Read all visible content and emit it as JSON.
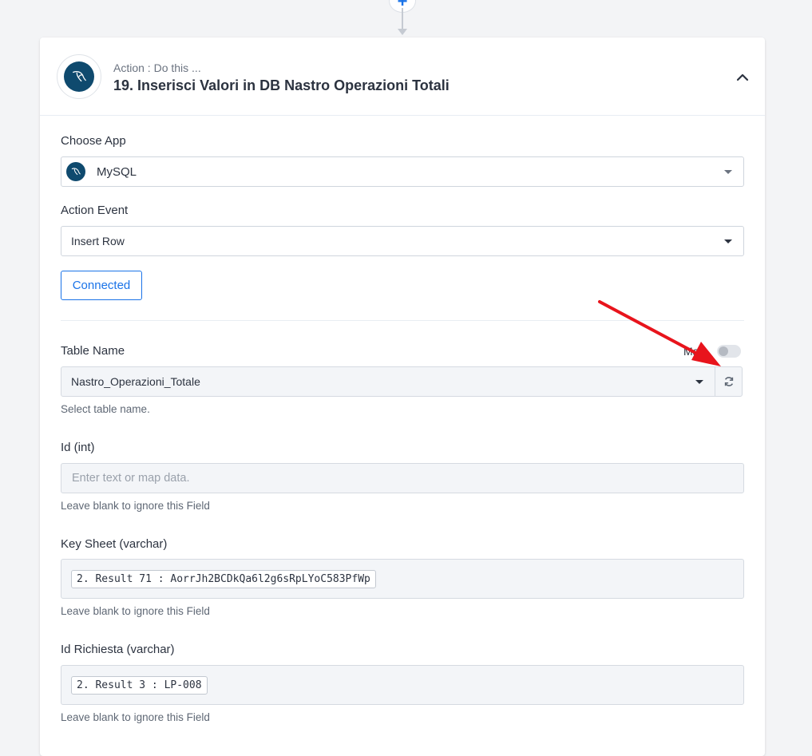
{
  "step": {
    "subtitle": "Action : Do this ...",
    "title": "19. Inserisci Valori in DB Nastro Operazioni Totali"
  },
  "choose_app": {
    "label": "Choose App",
    "value": "MySQL"
  },
  "action_event": {
    "label": "Action Event",
    "value": "Insert Row"
  },
  "connection": {
    "label": "Connected"
  },
  "table_name": {
    "label": "Table Name",
    "toggle_label": "Map",
    "value": "Nastro_Operazioni_Totale",
    "help": "Select table name."
  },
  "fields": [
    {
      "label": "Id (int)",
      "placeholder": "Enter text or map data.",
      "token": "",
      "help": "Leave blank to ignore this Field"
    },
    {
      "label": "Key Sheet (varchar)",
      "placeholder": "",
      "token": "2. Result 71 : AorrJh2BCDkQa6l2g6sRpLYoC583PfWp",
      "help": "Leave blank to ignore this Field"
    },
    {
      "label": "Id Richiesta (varchar)",
      "placeholder": "",
      "token": "2. Result 3 : LP-008",
      "help": "Leave blank to ignore this Field"
    }
  ],
  "colors": {
    "accent": "#1a73e8",
    "app_brand": "#0f4a6e",
    "annotation": "#e8141c"
  },
  "icons": {
    "app": "mysql-dolphin-icon",
    "collapse": "chevron-up-icon",
    "refresh": "refresh-icon",
    "add": "plus-icon"
  }
}
